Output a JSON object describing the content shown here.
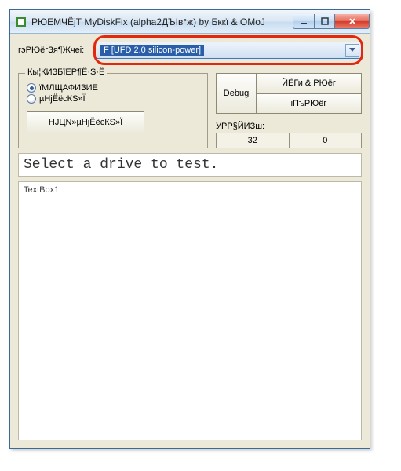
{
  "titlebar": {
    "title": "РЮЕМЧЁјТ MyDiskFix (alpha2ДЪІв°ж) by Бккї & OMoJ"
  },
  "drive": {
    "label": "гэРЮёгЗя¶Жчеі:",
    "selected": "F [UFD 2.0 silicon-power]"
  },
  "mode": {
    "legend": "Кы¦КИЗБїЕР¶Ё·S·Ё",
    "optFull": "їМЛЩАФИЗИЕ",
    "optLow": "µНјЁёcКS»Ї",
    "fixBtn": "НЈЦN»µНјЁёcКS»Ї"
  },
  "actions": {
    "debug": "Debug",
    "top": "ЙЁГи & РЮёг",
    "bot": "іПъРЮёг"
  },
  "stats": {
    "label": "УРР§ЙИЗш:",
    "a": "32",
    "b": "0"
  },
  "status": "Select a drive to test.",
  "textbox": "TextBox1"
}
